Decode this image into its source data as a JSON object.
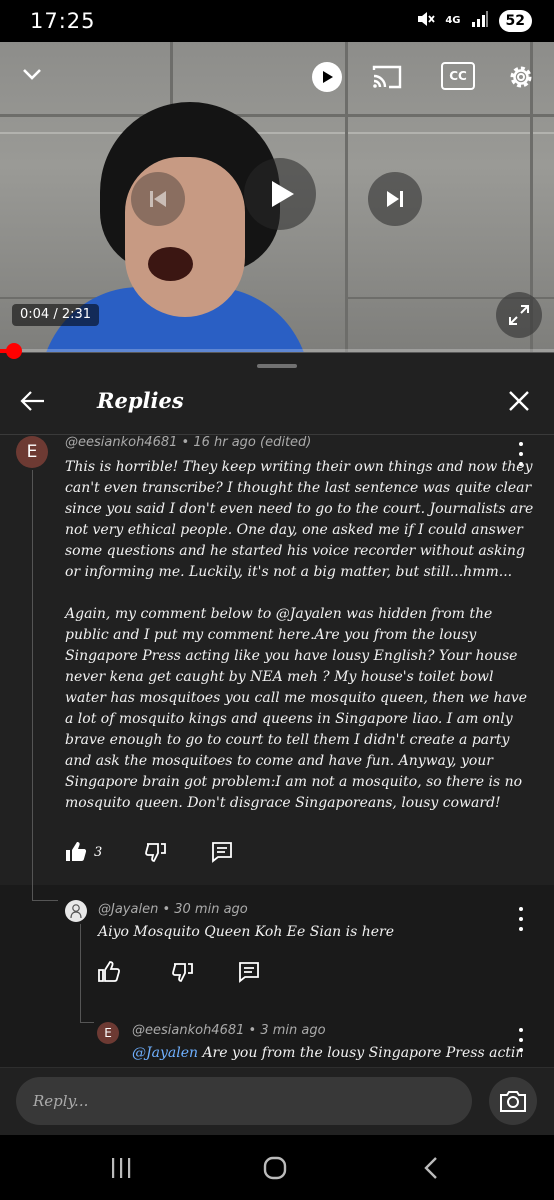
{
  "status_bar": {
    "time": "17:25",
    "network": "4G",
    "battery": "52",
    "icons": [
      "mute-icon",
      "signal-icon",
      "battery-icon"
    ]
  },
  "video": {
    "current_time": "0:04",
    "duration": "2:31",
    "time_display": "0:04 / 2:31",
    "progress_fraction": 0.026,
    "controls": [
      "collapse-chevron-icon",
      "autoplay-toggle-icon",
      "cast-icon",
      "captions-icon",
      "settings-gear-icon",
      "previous-icon",
      "play-icon",
      "next-icon",
      "fullscreen-icon"
    ],
    "captions_label": "CC"
  },
  "panel": {
    "title": "Replies",
    "main_comment": {
      "avatar_letter": "E",
      "handle": "@eesiankoh4681",
      "meta": "@eesiankoh4681 • 16 hr ago (edited)",
      "text": "This is horrible! They keep writing their own things and now they can't even transcribe? I thought the last sentence was quite clear since you said I don't even need to go to the court. Journalists are not very ethical people. One day, one asked me if I could answer some questions and he started his voice recorder without asking or informing me. Luckily, it's not a big matter, but still...hmm...\n\nAgain, my comment below to @Jayalen was hidden from the public and I put my comment here.Are you from the lousy Singapore Press acting like you have lousy English? Your house never kena get caught by NEA meh ? My house's toilet bowl water has mosquitoes you call me mosquito queen, then we have a lot of mosquito kings and queens in Singapore liao. I am only brave enough to go to court to tell them I didn't create a party and ask the mosquitoes to come and have fun. Anyway, your Singapore brain got problem:I am not a mosquito, so there is no mosquito queen. Don't disgrace Singaporeans, lousy coward!",
      "likes": "3"
    },
    "replies": [
      {
        "meta": "@Jayalen • 30 min ago",
        "text": "Aiyo Mosquito Queen Koh Ee Sian is here",
        "likes": ""
      },
      {
        "avatar_letter": "E",
        "meta": "@eesiankoh4681 • 3 min ago",
        "mention": "@Jayalen",
        "text": " Are you from the lousy Singapore Press acting"
      }
    ]
  },
  "reply_bar": {
    "placeholder": "Reply..."
  },
  "nav_bar": {
    "items": [
      "recents-icon",
      "home-icon",
      "back-icon"
    ]
  }
}
